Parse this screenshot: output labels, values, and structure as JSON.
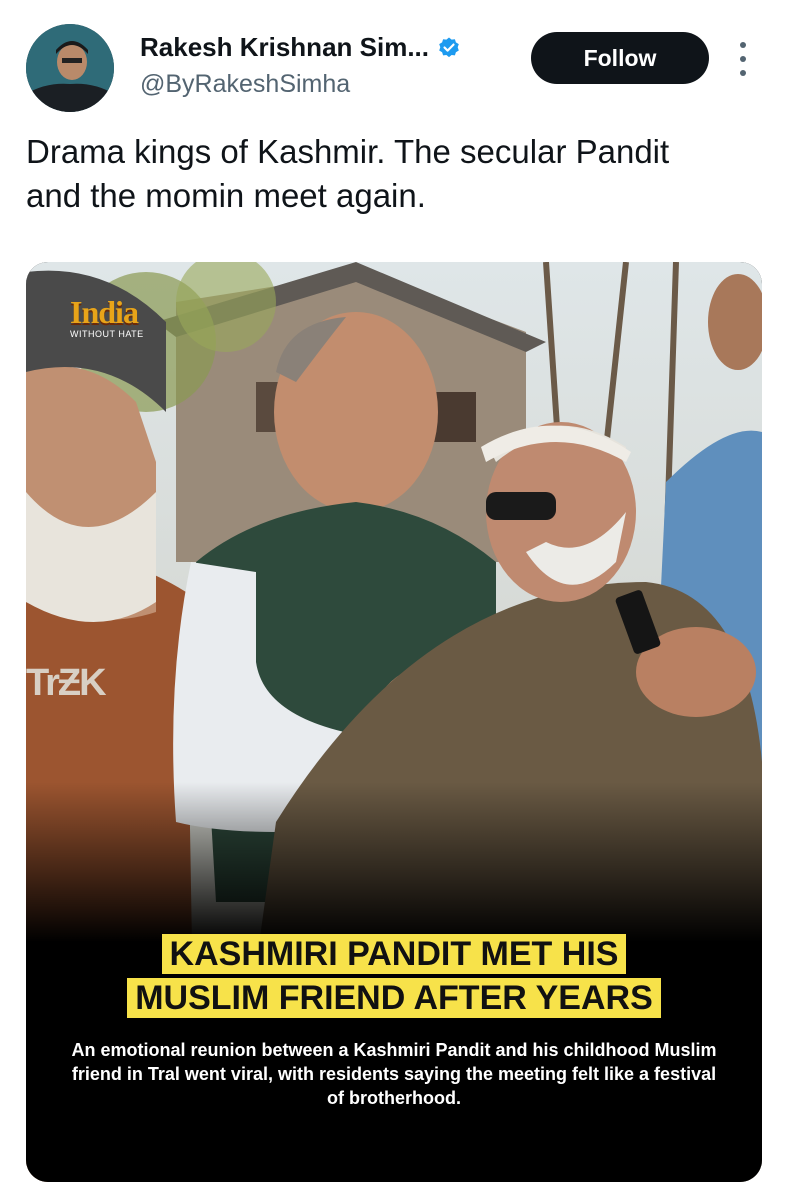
{
  "author": {
    "display_name": "Rakesh Krishnan Sim...",
    "handle": "@ByRakeshSimha",
    "avatar_icon": "profile-photo",
    "verified_icon": "verified-badge-icon",
    "verified_color": "#1d9bf0"
  },
  "follow_label": "Follow",
  "more_icon": "more-vertical-icon",
  "tweet_text": "Drama kings of Kashmir. The secular Pandit\nand the momin meet again.",
  "media": {
    "logo_main": "India",
    "logo_sub": "WITHOUT HATE",
    "shirt_text": "TrƵK",
    "headline_line1": "KASHMIRI PANDIT MET HIS",
    "headline_line2": "MUSLIM FRIEND AFTER YEARS",
    "caption": "An emotional reunion between a Kashmiri Pandit and his childhood Muslim friend in Tral went viral, with residents saying the meeting felt like a festival of brotherhood.",
    "headline_color": "#f7e24a"
  }
}
